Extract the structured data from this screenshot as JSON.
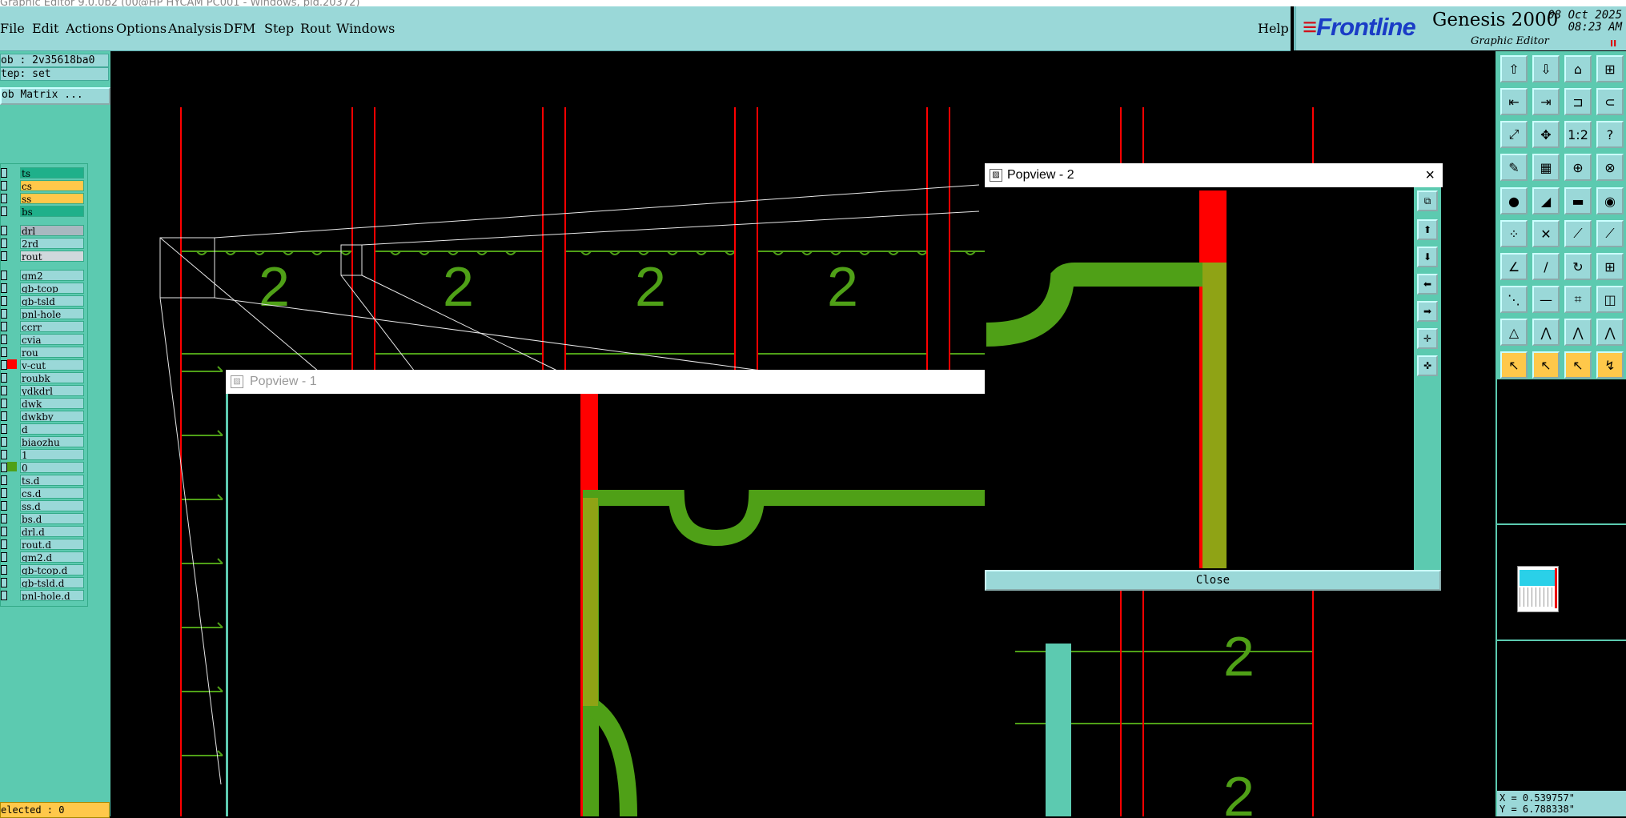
{
  "window": {
    "title": "Graphic Editor 9.0.0b2 (00@HP HYCAM PC001 - Windows, pid.20372)"
  },
  "menu": {
    "items": [
      "File",
      "Edit",
      "Actions",
      "Options",
      "Analysis",
      "DFM",
      "Step",
      "Rout",
      "Windows"
    ],
    "help": "Help"
  },
  "brand": {
    "logo": "Frontline",
    "title": "Genesis 2000",
    "subtitle": "Graphic Editor",
    "date": "08 Oct 2025",
    "time": "08:23 AM",
    "pause": "II"
  },
  "job": {
    "job_label": "ob : 2v35618ba0",
    "step_label": "tep: set",
    "matrix_button": "ob Matrix ..."
  },
  "layers": [
    {
      "name": "ts",
      "color": "#1fb08a"
    },
    {
      "name": "cs",
      "color": "#ffc84a"
    },
    {
      "name": "ss",
      "color": "#ffc84a"
    },
    {
      "name": "bs",
      "color": "#1fb08a"
    },
    {
      "name": "drl",
      "color": "#a8b8c0"
    },
    {
      "name": "2rd",
      "color": "#9ad8d8"
    },
    {
      "name": "rout",
      "color": "#d0d8dc"
    },
    {
      "name": "gm2",
      "color": "#9ad8d8"
    },
    {
      "name": "gb-tcop",
      "color": "#9ad8d8"
    },
    {
      "name": "gb-tsld",
      "color": "#9ad8d8"
    },
    {
      "name": "pnl-hole",
      "color": "#9ad8d8"
    },
    {
      "name": "ccrr",
      "color": "#9ad8d8"
    },
    {
      "name": "cvia",
      "color": "#9ad8d8"
    },
    {
      "name": "rou",
      "color": "#9ad8d8"
    },
    {
      "name": "v-cut",
      "color": "#9ad8d8"
    },
    {
      "name": "roubk",
      "color": "#9ad8d8"
    },
    {
      "name": "ydkdrl",
      "color": "#9ad8d8"
    },
    {
      "name": "dwk",
      "color": "#9ad8d8"
    },
    {
      "name": "dwkby",
      "color": "#9ad8d8"
    },
    {
      "name": "d",
      "color": "#9ad8d8"
    },
    {
      "name": "biaozhu",
      "color": "#9ad8d8"
    },
    {
      "name": "1",
      "color": "#9ad8d8"
    },
    {
      "name": "0",
      "color": "#9ad8d8"
    },
    {
      "name": "ts.d",
      "color": "#9ad8d8"
    },
    {
      "name": "cs.d",
      "color": "#9ad8d8"
    },
    {
      "name": "ss.d",
      "color": "#9ad8d8"
    },
    {
      "name": "bs.d",
      "color": "#9ad8d8"
    },
    {
      "name": "drl.d",
      "color": "#9ad8d8"
    },
    {
      "name": "rout.d",
      "color": "#9ad8d8"
    },
    {
      "name": "gm2.d",
      "color": "#9ad8d8"
    },
    {
      "name": "gb-tcop.d",
      "color": "#9ad8d8"
    },
    {
      "name": "gb-tsld.d",
      "color": "#9ad8d8"
    },
    {
      "name": "pnl-hole.d",
      "color": "#9ad8d8"
    }
  ],
  "selected": "elected : 0",
  "canvas": {
    "board_digit": "2"
  },
  "popview1": {
    "title": "Popview - 1"
  },
  "popview2": {
    "title": "Popview - 2",
    "close_label": "Close",
    "close_icon": "×"
  },
  "coords": {
    "x": "X = 0.539757\"",
    "y": "Y = 6.788338\""
  },
  "colors": {
    "panel": "#9ad8d8",
    "accent": "#5ccab0",
    "trace": "#4fa017",
    "vcut": "#ff0000",
    "highlight": "#ffc84a"
  }
}
